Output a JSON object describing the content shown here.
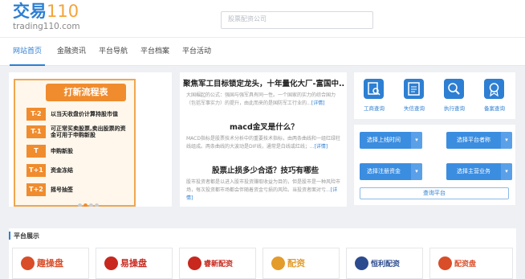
{
  "header": {
    "logo_cn": "交易",
    "logo_num": "110",
    "logo_sub": "trading110.com",
    "search_placeholder": "股票配资公司"
  },
  "nav": {
    "items": [
      "网站首页",
      "金融资讯",
      "平台导航",
      "平台档案",
      "平台活动"
    ]
  },
  "banner": {
    "title": "打新流程表",
    "steps": [
      {
        "tag": "T-2",
        "text": "以当天收盘价计算持股市值"
      },
      {
        "tag": "T-1",
        "text": "可正常买卖股票,卖出股票的资金可用于申购新股"
      },
      {
        "tag": "T",
        "text": "申购新股"
      },
      {
        "tag": "T+1",
        "text": "资金冻结"
      },
      {
        "tag": "T+2",
        "text": "摇号抽签"
      }
    ]
  },
  "news": [
    {
      "title": "聚焦军工目标锁定龙头，十年量化大厂-富国中...",
      "body": "大国崛起的公式：强国与强军具有同一性。一个国家的实力的综合国力（包括军事实力）的提升，由此而来的是国防军工行业的...",
      "more": "[详情]"
    },
    {
      "title": "macd金叉是什么？",
      "body": "MACD指标是股票技术分析中的重要技术指标，由两条曲线和一组红绿柱线组成。两条曲线的大波动是DIF线，通常是白线或红线；...",
      "more": "[详情]"
    },
    {
      "title": "股票止损多少合适？技巧有哪些",
      "body": "股市投资者都是以进入股市投资赚取收益为目的，但是股市是一种风险市场，每次投资都市场都会伴随着资金亏损的风险。当投资者面对亏...",
      "more": "[详情]"
    }
  ],
  "tools": [
    {
      "label": "工商查询",
      "icon": "search-doc-icon"
    },
    {
      "label": "失信查询",
      "icon": "list-check-icon"
    },
    {
      "label": "执行查询",
      "icon": "gavel-icon"
    },
    {
      "label": "备案查询",
      "icon": "badge-icon"
    }
  ],
  "filters": {
    "items": [
      "选择上线时间",
      "选择平台者称",
      "选择注册资金",
      "选择主营业务"
    ],
    "query": "查询平台"
  },
  "platform": {
    "title": "平台展示",
    "items": [
      {
        "name": "趣操盘",
        "color": "#d94d28"
      },
      {
        "name": "易操盘",
        "color": "#c8281e"
      },
      {
        "name": "睿新配资",
        "color": "#c8281e"
      },
      {
        "name": "配资",
        "color": "#e39b2a"
      },
      {
        "name": "恒利配资",
        "color": "#2c4b8f"
      },
      {
        "name": "配资盘",
        "color": "#d94d28"
      }
    ]
  },
  "colors": {
    "accent": "#2d7fd3",
    "orange": "#f08c2e"
  }
}
